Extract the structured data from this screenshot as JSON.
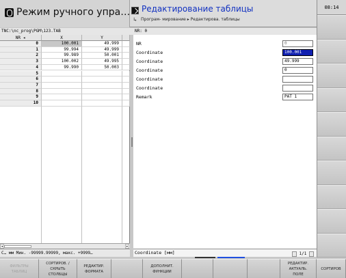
{
  "header": {
    "mode_title": "Режим ручного упра…",
    "program_title": "Редактирование таблицы",
    "breadcrumb": "Програм- мирование ▸ Редактирова. таблицы",
    "clock": "08:14"
  },
  "path": {
    "file": "TNC:\\nc_prog\\PGM\\123.TAB",
    "current_record": "NR: 0"
  },
  "table": {
    "columns": [
      "NR",
      "X",
      "Y"
    ],
    "rows": [
      {
        "nr": "0",
        "x": "100.001",
        "y": "49.999"
      },
      {
        "nr": "1",
        "x": "99.994",
        "y": "49.999"
      },
      {
        "nr": "2",
        "x": "99.989",
        "y": "50.001"
      },
      {
        "nr": "3",
        "x": "100.002",
        "y": "49.995"
      },
      {
        "nr": "4",
        "x": "99.990",
        "y": "50.003"
      },
      {
        "nr": "5",
        "x": "",
        "y": ""
      },
      {
        "nr": "6",
        "x": "",
        "y": ""
      },
      {
        "nr": "7",
        "x": "",
        "y": ""
      },
      {
        "nr": "8",
        "x": "",
        "y": ""
      },
      {
        "nr": "9",
        "x": "",
        "y": ""
      },
      {
        "nr": "10",
        "x": "",
        "y": ""
      }
    ]
  },
  "form": {
    "fields": [
      {
        "label": "NR",
        "value": "0"
      },
      {
        "label": "Coordinate",
        "value": "100.001"
      },
      {
        "label": "Coordinate",
        "value": "49.999"
      },
      {
        "label": "Coordinate",
        "value": "0"
      },
      {
        "label": "Coordinate",
        "value": ""
      },
      {
        "label": "Coordinate",
        "value": ""
      },
      {
        "label": "Remark",
        "value": "PAT 1"
      }
    ]
  },
  "status": {
    "left": "C… мм  Мин. -99999.99999, макс. +9999…",
    "right": "Coordinate [мм]",
    "pager": "1/1"
  },
  "softkeys": [
    "ФИЛЬТРЫ\nТАБЛИЦ",
    "СОРТИРОВ. /\nСКРЫТЬ\nСТОЛБЦЫ",
    "РЕДАКТИР.\nФОРМАТА",
    "",
    "ДОПОЛНИТ.\nФУНКЦИИ",
    "",
    "",
    "",
    "РЕДАКТИР.\nАКТУАЛЬ.\nПОЛЕ",
    "СОРТИРОВ"
  ],
  "colors": {
    "accent_blue": "#1030c0",
    "selection_blue": "#1020b0",
    "progress_dark": "#333333",
    "progress_blue": "#2050e0"
  }
}
